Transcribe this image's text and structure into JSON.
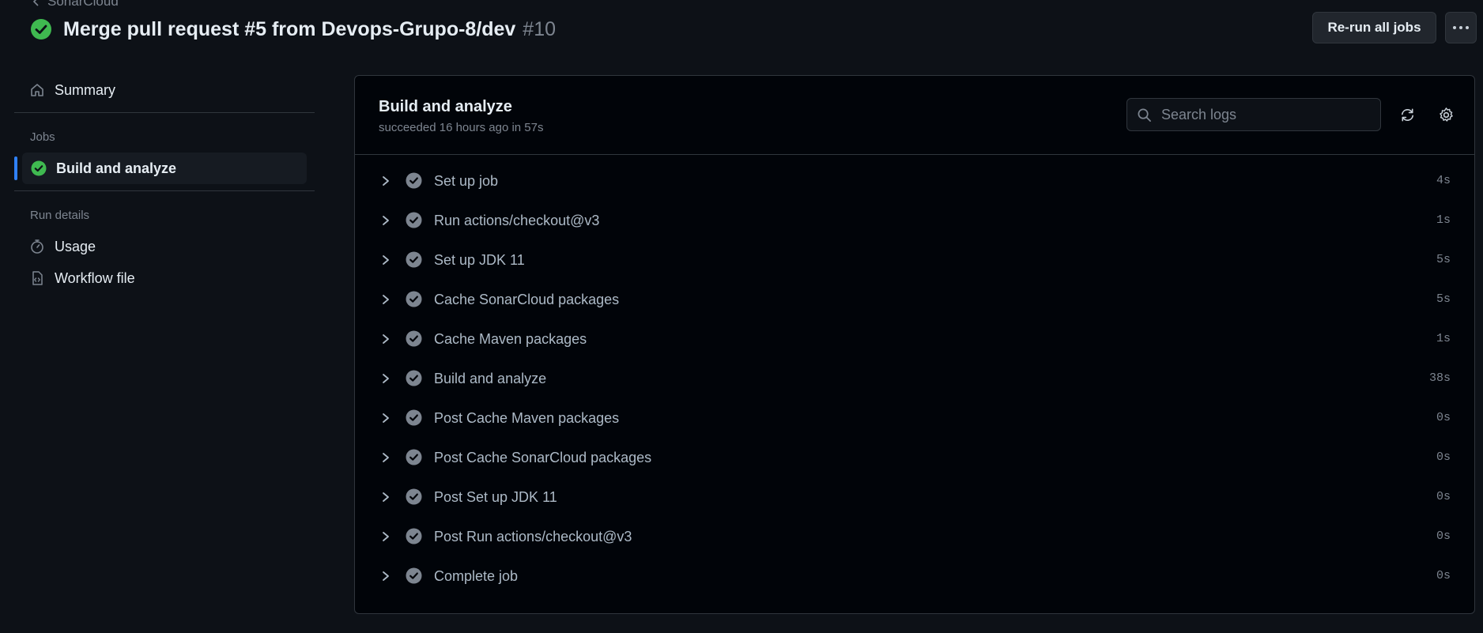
{
  "breadcrumb": {
    "label": "SonarCloud"
  },
  "header": {
    "title": "Merge pull request #5 from Devops-Grupo-8/dev",
    "run_number": "#10",
    "rerun_label": "Re-run all jobs"
  },
  "sidebar": {
    "summary_label": "Summary",
    "jobs_heading": "Jobs",
    "job_label": "Build and analyze",
    "run_details_heading": "Run details",
    "usage_label": "Usage",
    "workflow_file_label": "Workflow file"
  },
  "job": {
    "title": "Build and analyze",
    "subtitle": "succeeded 16 hours ago in 57s",
    "search_placeholder": "Search logs"
  },
  "steps": [
    {
      "name": "Set up job",
      "duration": "4s"
    },
    {
      "name": "Run actions/checkout@v3",
      "duration": "1s"
    },
    {
      "name": "Set up JDK 11",
      "duration": "5s"
    },
    {
      "name": "Cache SonarCloud packages",
      "duration": "5s"
    },
    {
      "name": "Cache Maven packages",
      "duration": "1s"
    },
    {
      "name": "Build and analyze",
      "duration": "38s"
    },
    {
      "name": "Post Cache Maven packages",
      "duration": "0s"
    },
    {
      "name": "Post Cache SonarCloud packages",
      "duration": "0s"
    },
    {
      "name": "Post Set up JDK 11",
      "duration": "0s"
    },
    {
      "name": "Post Run actions/checkout@v3",
      "duration": "0s"
    },
    {
      "name": "Complete job",
      "duration": "0s"
    }
  ],
  "icons": {
    "success": "check-circle-fill-icon",
    "step_done": "check-circle-icon",
    "expand": "chevron-right-icon"
  },
  "colors": {
    "background": "#0d1117",
    "panel": "#010409",
    "success": "#3fb950",
    "accent": "#2f81f7",
    "muted": "#7d8590",
    "step_check": "#7d8590"
  }
}
